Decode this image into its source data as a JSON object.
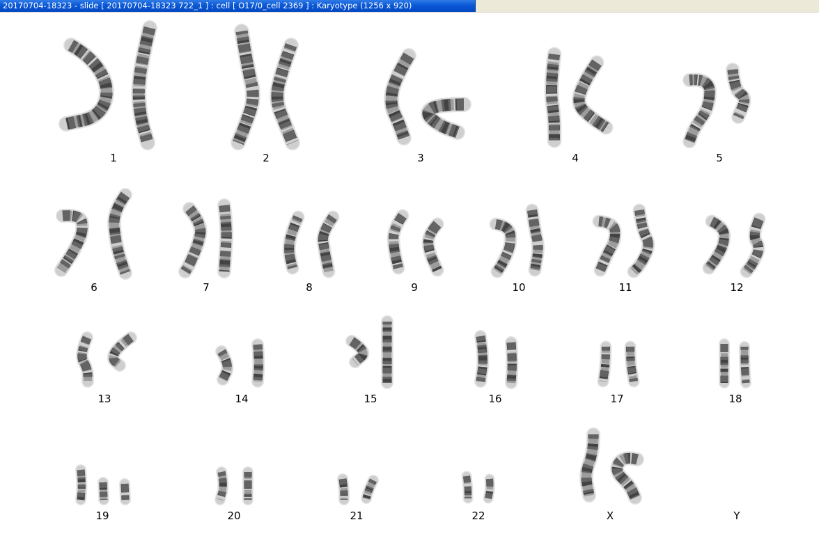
{
  "window": {
    "title": "20170704-18323 - slide [ 20170704-18323 722_1 ] : cell [ O17/0_cell 2369 ] : Karyotype  (1256 x 920)"
  },
  "colors": {
    "titlebar_active": "#0a58d6",
    "titlebar_inactive": "#ece9d8",
    "background": "#ffffff",
    "chromosome_light": "#cfcfcf",
    "chromosome_band": "#2a2a2a"
  },
  "karyotype": {
    "groups": [
      {
        "label": "1",
        "chromosome_count": 2
      },
      {
        "label": "2",
        "chromosome_count": 2
      },
      {
        "label": "3",
        "chromosome_count": 2
      },
      {
        "label": "4",
        "chromosome_count": 2
      },
      {
        "label": "5",
        "chromosome_count": 2
      },
      {
        "label": "6",
        "chromosome_count": 2
      },
      {
        "label": "7",
        "chromosome_count": 2
      },
      {
        "label": "8",
        "chromosome_count": 2
      },
      {
        "label": "9",
        "chromosome_count": 2
      },
      {
        "label": "10",
        "chromosome_count": 2
      },
      {
        "label": "11",
        "chromosome_count": 2
      },
      {
        "label": "12",
        "chromosome_count": 2
      },
      {
        "label": "13",
        "chromosome_count": 2
      },
      {
        "label": "14",
        "chromosome_count": 2
      },
      {
        "label": "15",
        "chromosome_count": 2
      },
      {
        "label": "16",
        "chromosome_count": 2
      },
      {
        "label": "17",
        "chromosome_count": 2
      },
      {
        "label": "18",
        "chromosome_count": 2
      },
      {
        "label": "19",
        "chromosome_count": 3
      },
      {
        "label": "20",
        "chromosome_count": 2
      },
      {
        "label": "21",
        "chromosome_count": 2
      },
      {
        "label": "22",
        "chromosome_count": 2
      },
      {
        "label": "X",
        "chromosome_count": 2
      },
      {
        "label": "Y",
        "chromosome_count": 0
      }
    ]
  }
}
